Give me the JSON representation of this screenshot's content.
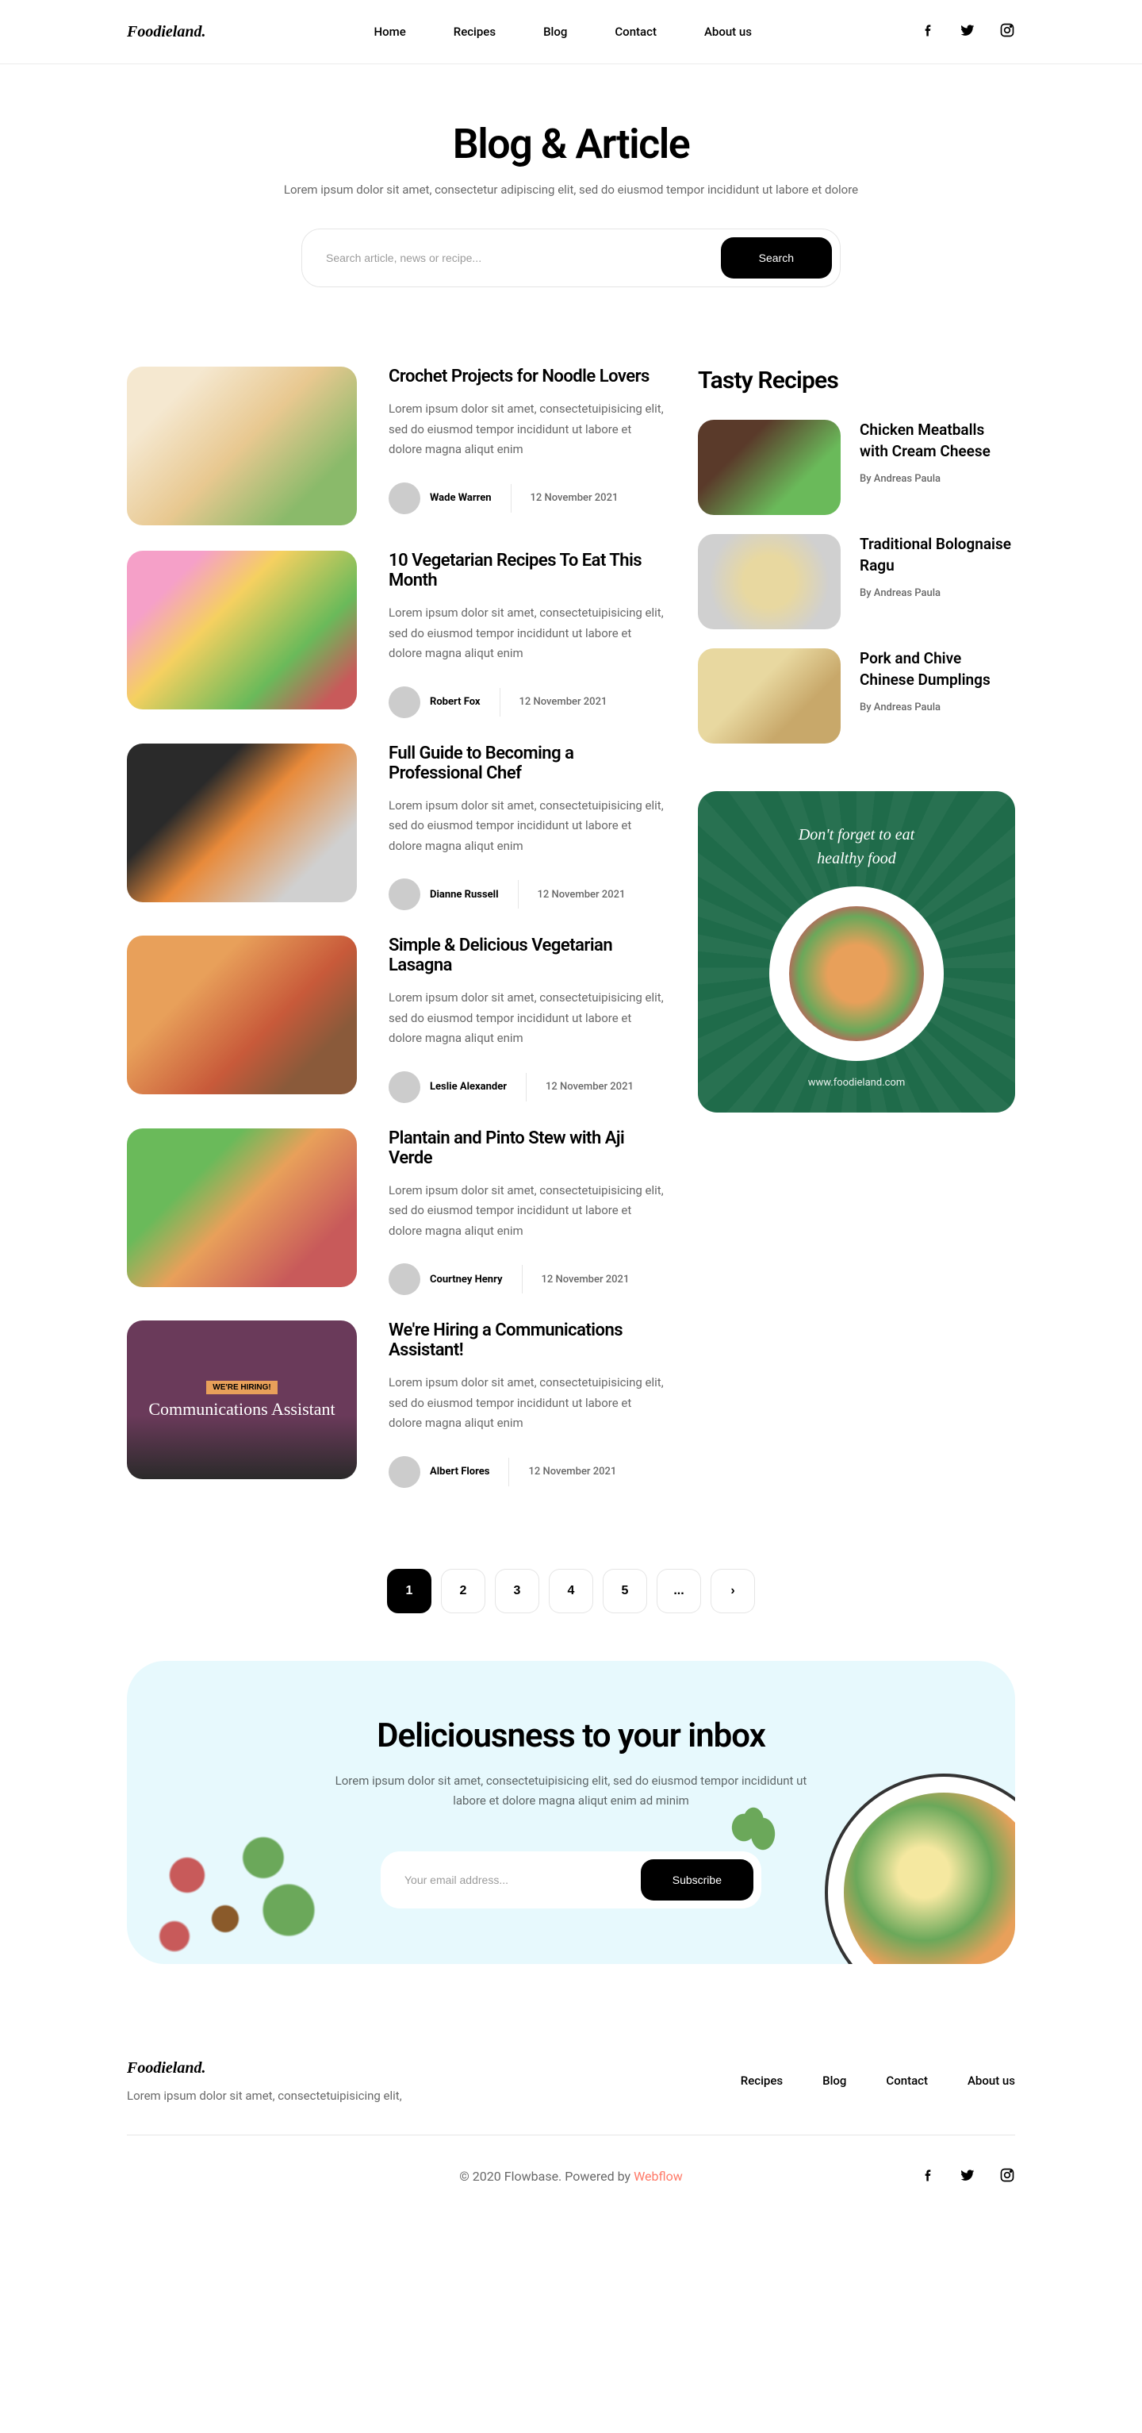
{
  "brand": "Foodieland.",
  "nav": [
    "Home",
    "Recipes",
    "Blog",
    "Contact",
    "About us"
  ],
  "hero": {
    "title": "Blog & Article",
    "subtitle": "Lorem ipsum dolor sit amet, consectetur adipiscing elit, sed do eiusmod tempor incididunt ut labore et dolore"
  },
  "search": {
    "placeholder": "Search article, news or recipe...",
    "button": "Search"
  },
  "posts": [
    {
      "title": "Crochet Projects for Noodle Lovers",
      "excerpt": "Lorem ipsum dolor sit amet, consectetuipisicing elit, sed do eiusmod tempor incididunt ut labore et dolore magna aliqut enim",
      "author": "Wade Warren",
      "date": "12 November 2021",
      "img": "linear-gradient(135deg,#f5e8d0 20%,#e8c890 50%,#8aba6a 80%)"
    },
    {
      "title": "10 Vegetarian Recipes To Eat This Month",
      "excerpt": "Lorem ipsum dolor sit amet, consectetuipisicing elit, sed do eiusmod tempor incididunt ut labore et dolore magna aliqut enim",
      "author": "Robert Fox",
      "date": "12 November 2021",
      "img": "linear-gradient(135deg,#f5a0c8 20%,#f5d060 40%,#6aba5a 70%,#c85a5a 90%)"
    },
    {
      "title": "Full Guide to Becoming a Professional Chef",
      "excerpt": "Lorem ipsum dolor sit amet, consectetuipisicing elit, sed do eiusmod tempor incididunt ut labore et dolore magna aliqut enim",
      "author": "Dianne Russell",
      "date": "12 November 2021",
      "img": "linear-gradient(135deg,#2a2a2a 30%,#e88a3a 50%,#d0d0d0 80%)"
    },
    {
      "title": "Simple & Delicious Vegetarian Lasagna",
      "excerpt": "Lorem ipsum dolor sit amet, consectetuipisicing elit, sed do eiusmod tempor incididunt ut labore et dolore magna aliqut enim",
      "author": "Leslie Alexander",
      "date": "12 November 2021",
      "img": "linear-gradient(135deg,#e8a05a 30%,#c85a3a 60%,#8a5a3a 80%)"
    },
    {
      "title": "Plantain and Pinto Stew with Aji Verde",
      "excerpt": "Lorem ipsum dolor sit amet, consectetuipisicing elit, sed do eiusmod tempor incididunt ut labore et dolore magna aliqut enim",
      "author": "Courtney Henry",
      "date": "12 November 2021",
      "img": "linear-gradient(135deg,#6aba5a 30%,#e8a05a 50%,#c85a5a 80%)"
    },
    {
      "title": "We're Hiring a Communications Assistant!",
      "excerpt": "Lorem ipsum dolor sit amet, consectetuipisicing elit, sed do eiusmod tempor incididunt ut labore et dolore magna aliqut enim",
      "author": "Albert Flores",
      "date": "12 November 2021",
      "img": "linear-gradient(180deg,#6a3a5a 60%,#2a2a2a 100%)",
      "badge": "WE'RE HIRING!",
      "overlay": "Communications Assistant"
    }
  ],
  "sidebar": {
    "heading": "Tasty Recipes",
    "items": [
      {
        "title": "Chicken Meatballs with Cream Cheese",
        "byline": "By Andreas Paula",
        "img": "linear-gradient(135deg,#5a3a2a 30%,#6aba5a 70%)"
      },
      {
        "title": "Traditional Bolognaise Ragu",
        "byline": "By Andreas Paula",
        "img": "radial-gradient(circle,#e8d8a0 30%,#d0d0d0 70%)"
      },
      {
        "title": "Pork and Chive Chinese Dumplings",
        "byline": "By Andreas Paula",
        "img": "linear-gradient(135deg,#e8d8a0 40%,#c8a86a 70%)"
      }
    ]
  },
  "promo": {
    "line1": "Don't forget to eat",
    "line2": "healthy food",
    "url": "www.foodieland.com"
  },
  "pagination": [
    "1",
    "2",
    "3",
    "4",
    "5",
    "...",
    "›"
  ],
  "newsletter": {
    "title": "Deliciousness to your inbox",
    "text": "Lorem ipsum dolor sit amet, consectetuipisicing elit, sed do eiusmod tempor incididunt ut labore et dolore magna aliqut enim ad minim",
    "placeholder": "Your email address...",
    "button": "Subscribe"
  },
  "footer": {
    "tagline": "Lorem ipsum dolor sit amet, consectetuipisicing elit,",
    "nav": [
      "Recipes",
      "Blog",
      "Contact",
      "About us"
    ],
    "copyright": "© 2020 Flowbase. Powered by ",
    "powered": "Webflow"
  }
}
